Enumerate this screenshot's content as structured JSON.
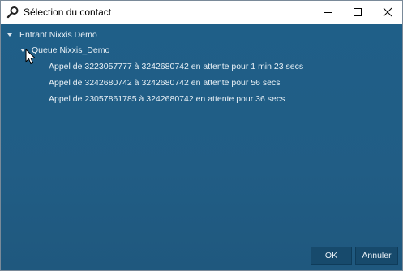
{
  "window": {
    "title": "Sélection du contact",
    "icon": "magnifier-icon"
  },
  "controls": {
    "minimize_icon": "minimize-icon",
    "maximize_icon": "maximize-icon",
    "close_icon": "close-icon"
  },
  "tree": {
    "root": {
      "label": "Entrant Nixxis Demo",
      "expanded": true
    },
    "queue": {
      "label": "Queue Nixxis_Demo",
      "expanded": true
    },
    "calls": [
      {
        "label": "Appel de 3223057777 à 3242680742 en attente pour 1 min 23 secs"
      },
      {
        "label": "Appel de 3242680742 à 3242680742 en attente pour 56 secs"
      },
      {
        "label": "Appel de 23057861785 à 3242680742 en attente pour 36 secs"
      }
    ]
  },
  "footer": {
    "ok_label": "OK",
    "cancel_label": "Annuler"
  },
  "colors": {
    "background": "#1f5c84",
    "text": "#e8f0f6",
    "button_bg": "#174a6c"
  }
}
